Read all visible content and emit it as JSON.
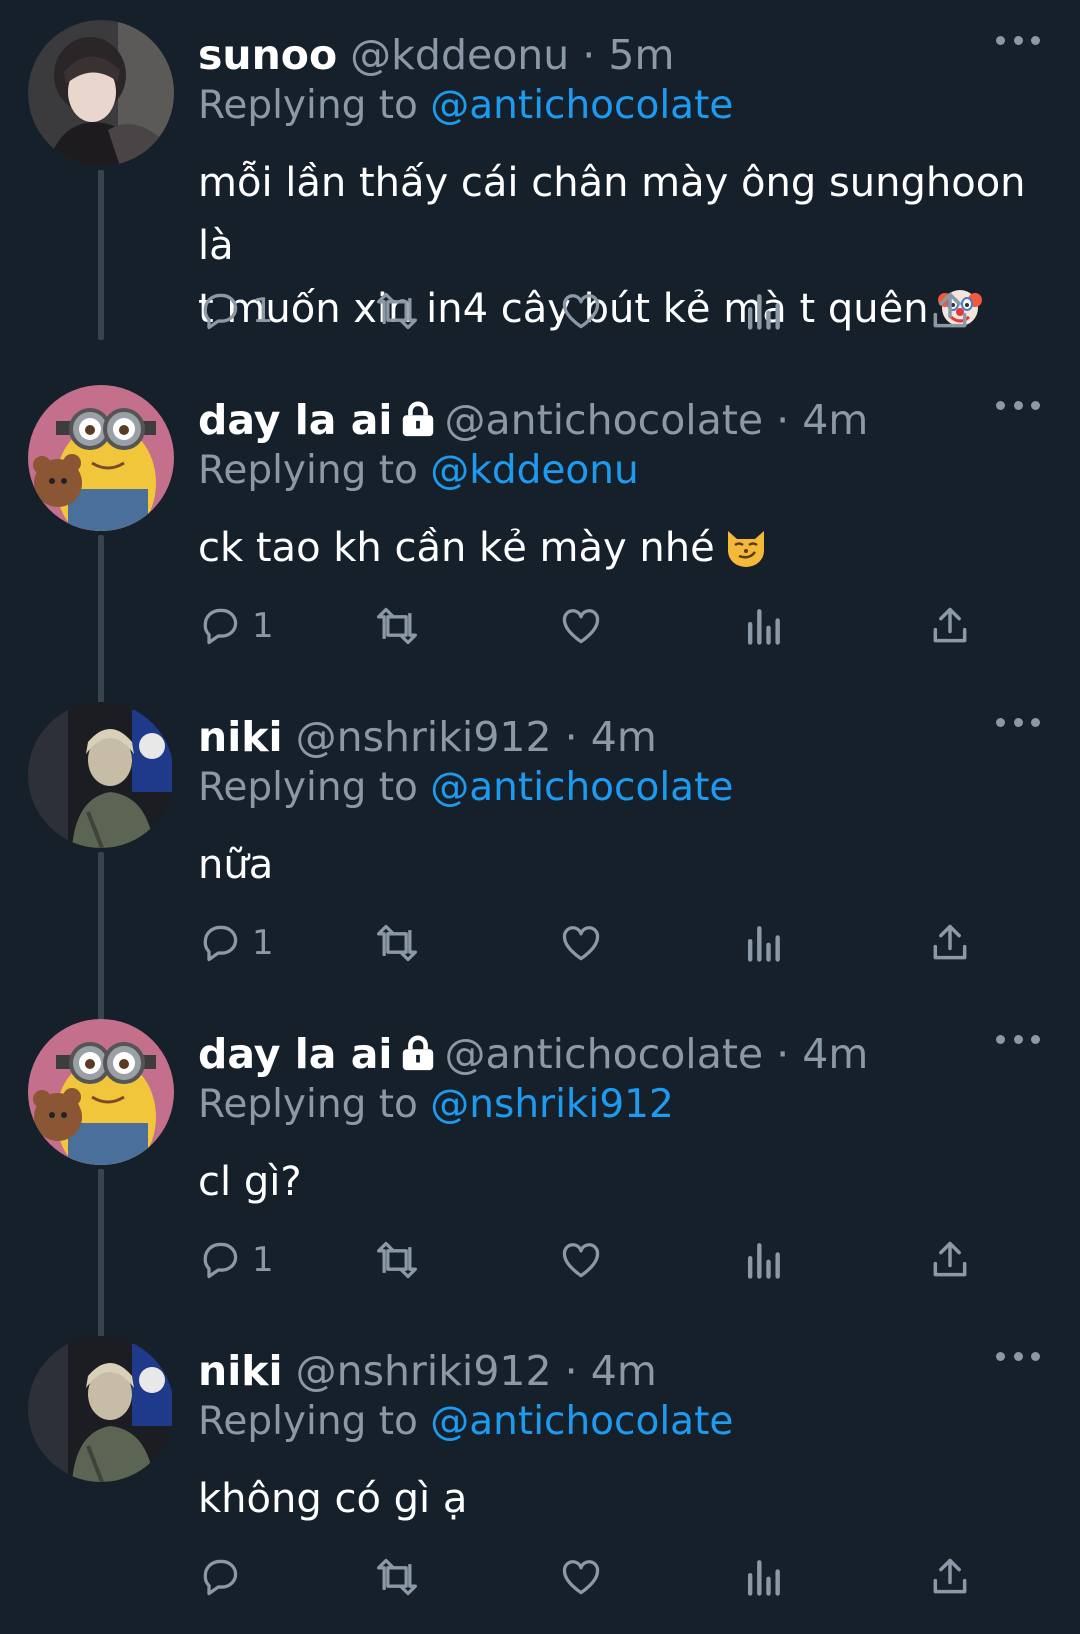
{
  "tweets": [
    {
      "name": "sunoo",
      "handle": "@kddeonu",
      "separator": "·",
      "time": "5m",
      "replying_prefix": "Replying to",
      "replying_to": "@antichocolate",
      "lines": [
        "mỗi lần thấy cái chân mày ông sunghoon là",
        "t muốn xin in4 cây bút kẻ mà t quên"
      ],
      "emoji": "clown-face",
      "locked": false,
      "reply_count": "1",
      "avatar": "photo-person-dark"
    },
    {
      "name": "day la ai",
      "handle": "@antichocolate",
      "separator": "·",
      "time": "4m",
      "replying_prefix": "Replying to",
      "replying_to": "@kddeonu",
      "lines": [
        "ck tao kh cần kẻ mày nhé"
      ],
      "emoji": "smirking-cat",
      "locked": true,
      "reply_count": "1",
      "avatar": "minion"
    },
    {
      "name": "niki",
      "handle": "@nshriki912",
      "separator": "·",
      "time": "4m",
      "replying_prefix": "Replying to",
      "replying_to": "@antichocolate",
      "lines": [
        "nữa"
      ],
      "emoji": "",
      "locked": false,
      "reply_count": "1",
      "avatar": "photo-person-store"
    },
    {
      "name": "day la ai",
      "handle": "@antichocolate",
      "separator": "·",
      "time": "4m",
      "replying_prefix": "Replying to",
      "replying_to": "@nshriki912",
      "lines": [
        "cl gì?"
      ],
      "emoji": "",
      "locked": true,
      "reply_count": "1",
      "avatar": "minion"
    },
    {
      "name": "niki",
      "handle": "@nshriki912",
      "separator": "·",
      "time": "4m",
      "replying_prefix": "Replying to",
      "replying_to": "@antichocolate",
      "lines": [
        "không có gì ạ"
      ],
      "emoji": "",
      "locked": false,
      "reply_count": "",
      "avatar": "photo-person-store"
    }
  ],
  "icons": {
    "more": "more-horizontal-icon",
    "reply": "reply-icon",
    "retweet": "retweet-icon",
    "like": "heart-icon",
    "views": "views-icon",
    "share": "share-icon",
    "lock": "lock-icon"
  },
  "colors": {
    "background": "#15202b",
    "text": "#ffffff",
    "muted": "#8b98a5",
    "link": "#1d9bf0",
    "thread_line": "#38444d"
  }
}
